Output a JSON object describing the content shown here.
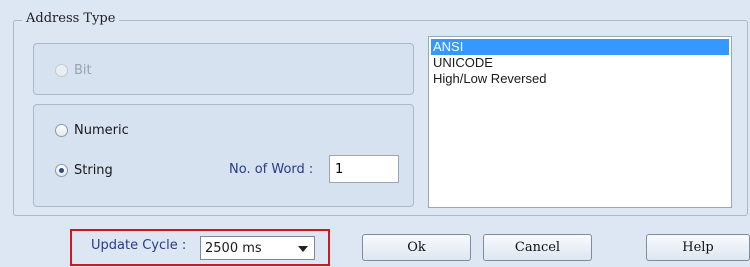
{
  "group": {
    "title": "Address Type"
  },
  "bit_radio": {
    "label": "Bit",
    "enabled": false,
    "checked": false
  },
  "numeric_radio": {
    "label": "Numeric",
    "checked": false
  },
  "string_radio": {
    "label": "String",
    "checked": true
  },
  "word": {
    "label": "No. of Word :",
    "value": "1"
  },
  "encoding_list": {
    "items": [
      "ANSI",
      "UNICODE",
      "High/Low Reversed"
    ],
    "selected": "ANSI"
  },
  "update_cycle": {
    "label": "Update Cycle :",
    "value": "2500 ms"
  },
  "buttons": {
    "ok": "Ok",
    "cancel": "Cancel",
    "help": "Help"
  },
  "colors": {
    "selection": "#3399ff",
    "highlight_border": "#d0161e",
    "label_blue": "#2a3a8a"
  }
}
